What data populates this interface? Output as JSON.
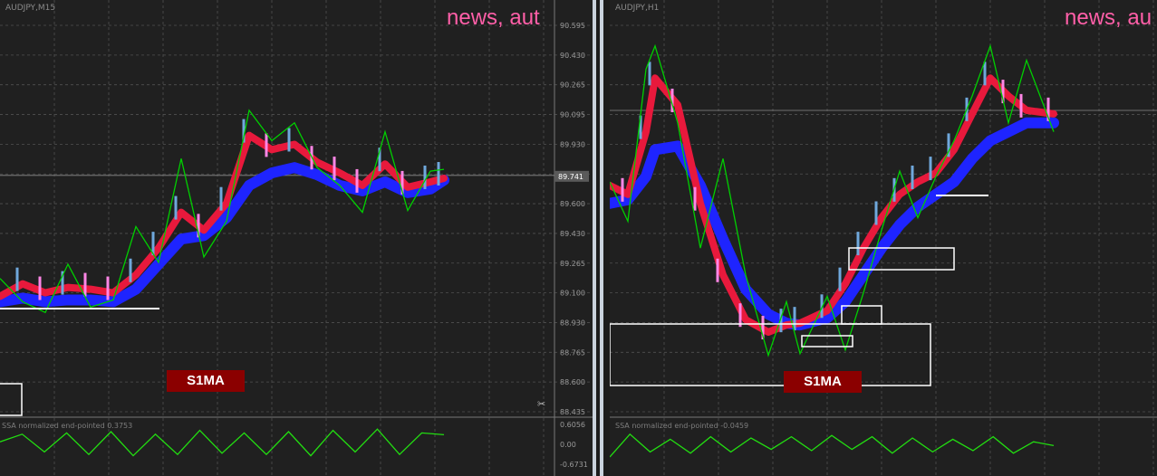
{
  "colors": {
    "background": "#202020",
    "grid": "#505050",
    "price_bars_up": "#6fa8dc",
    "price_bars_down": "#ff86e6",
    "zigzag": "#00d000",
    "ma_fast": "#e8193c",
    "ma_slow": "#1e24ff",
    "oscillator": "#22dd11",
    "news_text": "#ff5fa8",
    "badge": "#8b0000"
  },
  "left_panel": {
    "symbol_label": "AUDJPY,M15",
    "news_text": "news, aut",
    "badge_text": "S1MA",
    "indicator_label": "SSA normalized end-pointed 0.3753",
    "current_price_label": "89.741",
    "price_ticks": [
      "90.595",
      "90.430",
      "90.265",
      "90.095",
      "89.930",
      "89.760",
      "89.600",
      "89.430",
      "89.265",
      "89.100",
      "88.930",
      "88.765",
      "88.600",
      "88.435"
    ],
    "indicator_ticks": [
      "0.6056",
      "0.00",
      "-0.6731"
    ]
  },
  "right_panel": {
    "symbol_label": "AUDJPY,H1",
    "news_text": "news, au",
    "badge_text": "S1MA",
    "indicator_label": "SSA normalized end-pointed -0.0459"
  },
  "chart_data": [
    {
      "type": "line",
      "title": "AUDJPY,M15",
      "ylim": [
        88.435,
        90.595
      ],
      "x": [
        0,
        25,
        50,
        75,
        100,
        125,
        150,
        175,
        200,
        225,
        250,
        275,
        300,
        325,
        350,
        375,
        400,
        425,
        450,
        475,
        490
      ],
      "series": [
        {
          "name": "zigzag",
          "values": [
            89.18,
            89.05,
            88.99,
            89.26,
            89.02,
            89.06,
            89.47,
            89.27,
            89.85,
            89.3,
            89.5,
            90.12,
            89.95,
            90.05,
            89.8,
            89.7,
            89.55,
            90.0,
            89.56,
            89.78,
            89.79
          ]
        },
        {
          "name": "",
          "values": [
            89.08,
            89.15,
            89.1,
            89.13,
            89.12,
            89.1,
            89.2,
            89.35,
            89.55,
            89.45,
            89.6,
            89.98,
            89.9,
            89.93,
            89.83,
            89.77,
            89.7,
            89.82,
            89.69,
            89.72,
            89.74
          ]
        },
        {
          "name": "",
          "values": [
            89.05,
            89.07,
            89.05,
            89.06,
            89.06,
            89.05,
            89.12,
            89.26,
            89.4,
            89.42,
            89.52,
            89.7,
            89.77,
            89.8,
            89.76,
            89.7,
            89.67,
            89.72,
            89.66,
            89.68,
            89.73
          ]
        }
      ],
      "oscillator": [
        0.1,
        0.4,
        -0.3,
        0.45,
        -0.4,
        0.5,
        -0.45,
        0.4,
        -0.4,
        0.55,
        -0.35,
        0.45,
        -0.4,
        0.5,
        -0.45,
        0.55,
        -0.3,
        0.6,
        -0.4,
        0.45,
        0.38
      ]
    },
    {
      "type": "line",
      "title": "AUDJPY,H1",
      "ylim": [
        88.435,
        90.595
      ],
      "x": [
        0,
        20,
        40,
        50,
        75,
        100,
        125,
        150,
        175,
        195,
        210,
        240,
        260,
        280,
        300,
        320,
        340,
        360,
        380,
        400,
        420,
        440,
        460,
        490
      ],
      "series": [
        {
          "name": "zigzag",
          "values": [
            89.72,
            89.5,
            90.35,
            90.48,
            90.05,
            89.35,
            89.85,
            89.2,
            88.75,
            89.05,
            88.76,
            89.08,
            88.78,
            89.1,
            89.45,
            89.78,
            89.52,
            89.75,
            89.95,
            90.2,
            90.48,
            90.05,
            90.4,
            90.0
          ]
        },
        {
          "name": "",
          "values": [
            89.7,
            89.65,
            90.0,
            90.3,
            90.15,
            89.6,
            89.2,
            88.95,
            88.88,
            88.92,
            88.93,
            89.0,
            89.15,
            89.35,
            89.52,
            89.65,
            89.72,
            89.77,
            89.9,
            90.1,
            90.3,
            90.2,
            90.12,
            90.1
          ]
        },
        {
          "name": "",
          "values": [
            89.6,
            89.62,
            89.75,
            89.9,
            89.92,
            89.7,
            89.4,
            89.12,
            88.98,
            88.93,
            88.92,
            88.96,
            89.05,
            89.2,
            89.35,
            89.48,
            89.58,
            89.65,
            89.72,
            89.85,
            89.95,
            90.0,
            90.05,
            90.05
          ]
        }
      ],
      "oscillator": [
        -0.5,
        0.4,
        -0.3,
        0.2,
        -0.35,
        0.3,
        -0.3,
        0.25,
        -0.2,
        0.3,
        -0.25,
        0.35,
        -0.2,
        0.3,
        -0.35,
        0.25,
        -0.3,
        0.2,
        -0.25,
        0.3,
        -0.35,
        0.1,
        -0.05
      ]
    }
  ]
}
